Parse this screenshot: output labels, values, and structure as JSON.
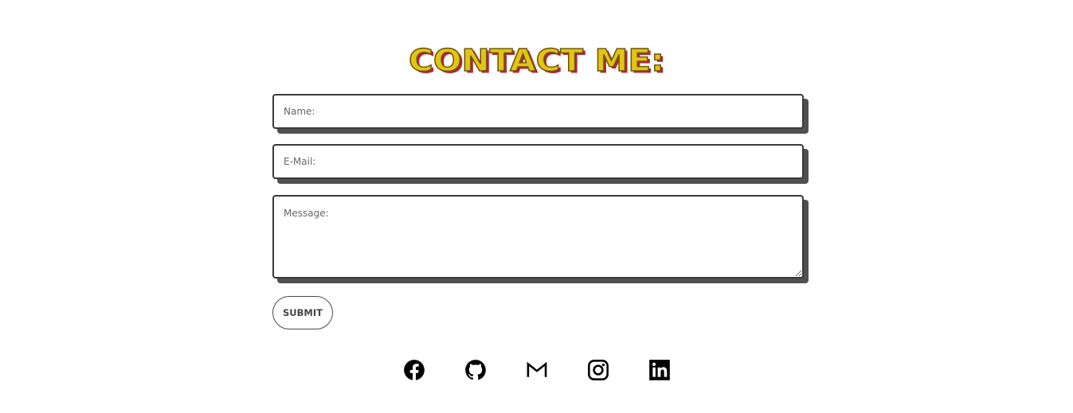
{
  "contact": {
    "title": "CONTACT ME:"
  },
  "form": {
    "name_placeholder": "Name:",
    "email_placeholder": "E-Mail:",
    "message_placeholder": "Message:",
    "submit_label": "SUBMIT"
  },
  "socials": [
    {
      "name": "facebook",
      "icon": "facebook-icon"
    },
    {
      "name": "github",
      "icon": "github-icon"
    },
    {
      "name": "gmail",
      "icon": "gmail-icon"
    },
    {
      "name": "instagram",
      "icon": "instagram-icon"
    },
    {
      "name": "linkedin",
      "icon": "linkedin-icon"
    }
  ],
  "colors": {
    "title_fill": "#e2c415",
    "title_outline": "#6a5200",
    "title_shadow": "#b8233b",
    "field_shadow": "#505050"
  }
}
